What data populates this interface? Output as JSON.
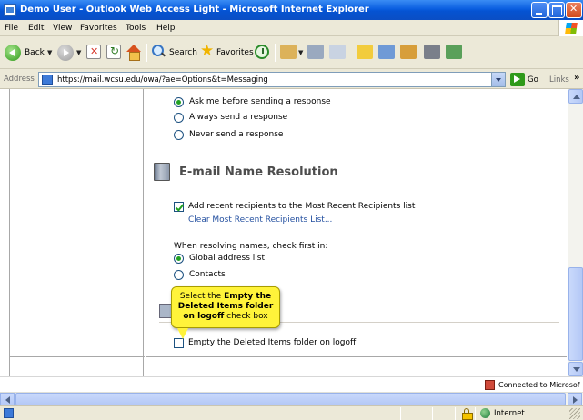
{
  "window": {
    "title": "Demo User - Outlook Web Access Light - Microsoft Internet Explorer"
  },
  "menu": [
    "File",
    "Edit",
    "View",
    "Favorites",
    "Tools",
    "Help"
  ],
  "toolbar": {
    "back_label": "Back",
    "search_label": "Search",
    "favorites_label": "Favorites"
  },
  "address": {
    "label": "Address",
    "url": "https://mail.wcsu.edu/owa/?ae=Options&t=Messaging",
    "go_label": "Go",
    "links_label": "Links",
    "overflow": "»"
  },
  "read_receipt": {
    "options": [
      {
        "label": "Ask me before sending a response",
        "selected": true
      },
      {
        "label": "Always send a response",
        "selected": false
      },
      {
        "label": "Never send a response",
        "selected": false
      }
    ]
  },
  "name_resolution": {
    "heading": "E-mail Name Resolution",
    "add_recent_label": "Add recent recipients to the Most Recent Recipients list",
    "add_recent_checked": true,
    "clear_link": "Clear Most Recent Recipients List...",
    "resolve_intro": "When resolving names, check first in:",
    "options": [
      {
        "label": "Global address list",
        "selected": true
      },
      {
        "label": "Contacts",
        "selected": false
      }
    ]
  },
  "deleted_items": {
    "empty_label": "Empty the Deleted Items folder on logoff",
    "checked": false
  },
  "callout": {
    "prefix": "Select the ",
    "bold": "Empty the Deleted Items folder on logoff",
    "suffix": " check box"
  },
  "inner_status": {
    "text": "Connected to Microsof"
  },
  "statusbar": {
    "zone": "Internet"
  }
}
